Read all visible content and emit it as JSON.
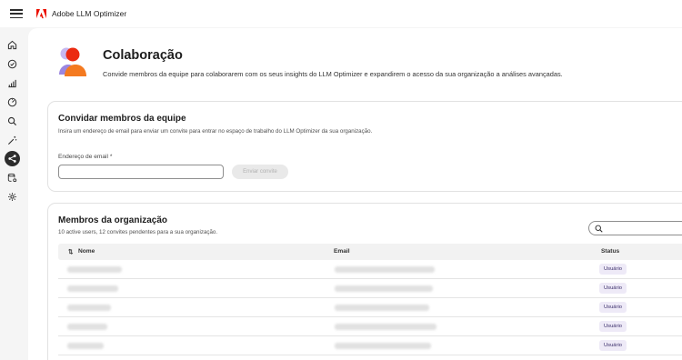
{
  "app": {
    "name": "Adobe LLM Optimizer",
    "brand_color": "#eb1000"
  },
  "sidebar": {
    "items": [
      {
        "icon": "home-icon"
      },
      {
        "icon": "check-circle-icon"
      },
      {
        "icon": "bar-chart-icon"
      },
      {
        "icon": "gauge-icon"
      },
      {
        "icon": "search-icon"
      },
      {
        "icon": "magic-wand-icon"
      },
      {
        "icon": "share-icon",
        "active": true
      },
      {
        "icon": "data-settings-icon"
      },
      {
        "icon": "gear-icon"
      }
    ]
  },
  "page": {
    "title": "Colaboração",
    "subtitle": "Convide membros da equipe para colaborarem com os seus insights do LLM Optimizer e expandirem o acesso da sua organização a análises avançadas."
  },
  "invite": {
    "title": "Convidar membros da equipe",
    "description": "Insira um endereço de email para enviar um convite para entrar no espaço de trabalho do LLM Optimizer da sua organização.",
    "email_label": "Endereço de email",
    "required_mark": "*",
    "email_value": "",
    "send_label": "Enviar convite"
  },
  "members": {
    "title": "Membros da organização",
    "summary": "10 active users, 12 convites pendentes para a sua organização.",
    "search_placeholder": "",
    "columns": {
      "name": "Nome",
      "email": "Email",
      "status": "Status"
    },
    "rows": [
      {
        "status": "Usuário"
      },
      {
        "status": "Usuário"
      },
      {
        "status": "Usuário"
      },
      {
        "status": "Usuário"
      },
      {
        "status": "Usuário"
      }
    ]
  }
}
